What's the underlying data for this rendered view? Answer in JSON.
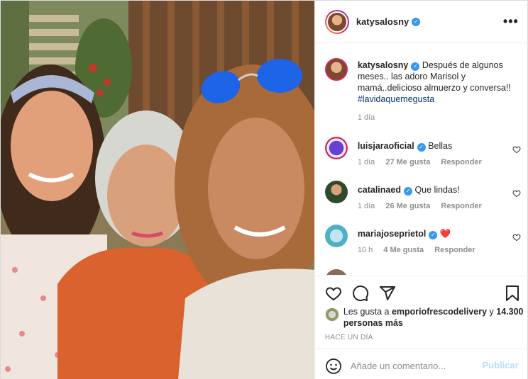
{
  "post": {
    "author": "katysalosny",
    "more_icon": "more-options-icon",
    "caption": {
      "username": "katysalosny",
      "text": "Después de algunos meses.. las adoro Marisol y mamá..delicioso almuerzo y conversa!!",
      "hashtag": "#lavidaquemegusta",
      "time": "1 día"
    },
    "comments": [
      {
        "username": "luisjaraoficial",
        "verified": true,
        "text": "Bellas",
        "time": "1 día",
        "likes": "27 Me gusta",
        "reply": "Responder"
      },
      {
        "username": "catalinaed",
        "verified": true,
        "text": "Que lindas!",
        "time": "1 día",
        "likes": "26 Me gusta",
        "reply": "Responder"
      },
      {
        "username": "mariajoseprietol",
        "verified": true,
        "text": "❤️",
        "time": "10 h",
        "likes": "4 Me gusta",
        "reply": "Responder"
      }
    ],
    "actions": {
      "icons": [
        "heart-icon",
        "comment-icon",
        "share-icon",
        "bookmark-icon"
      ]
    },
    "likes": {
      "prefix": "Les gusta a",
      "user": "emporiofrescodelivery",
      "joiner": "y",
      "count": "14.300 personas más"
    },
    "timestamp": "HACE UN DÍA",
    "add_comment": {
      "placeholder": "Añade un comentario...",
      "submit": "Publicar"
    }
  },
  "colors": {
    "verified": "#3897f0",
    "hashtag": "#00376b",
    "muted": "#8e8e8e",
    "publish_disabled": "#b2dffc",
    "heart_red": "#ed4956"
  }
}
